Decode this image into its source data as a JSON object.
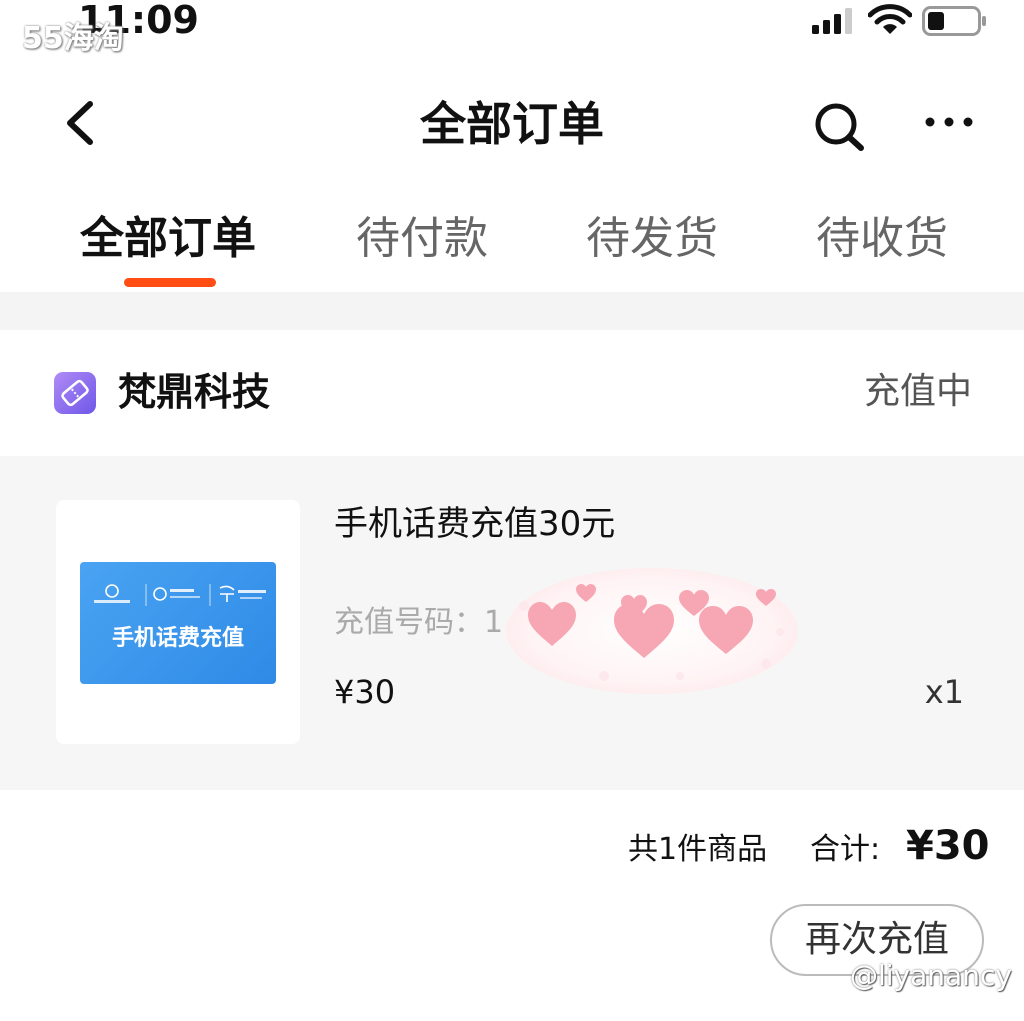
{
  "status_bar": {
    "time": "11:09",
    "battery_level": 0.35
  },
  "watermark": {
    "top": "55海淘",
    "bottom": "@liyanancy"
  },
  "header": {
    "title": "全部订单"
  },
  "tabs": [
    {
      "label": "全部订单",
      "active": true
    },
    {
      "label": "待付款",
      "active": false
    },
    {
      "label": "待发货",
      "active": false
    },
    {
      "label": "待收货",
      "active": false
    }
  ],
  "order": {
    "shop_name": "梵鼎科技",
    "status": "充值中",
    "thumbnail_text": "手机话费充值",
    "item_name": "手机话费充值30元",
    "recharge_number": "充值号码：1",
    "price": "¥30",
    "quantity": "x1",
    "total_count": "共1件商品",
    "total_label": "合计:",
    "total_amount": "¥30",
    "action_label": "再次充值"
  },
  "colors": {
    "accent": "#ff4d14",
    "banner_blue": "#3a93ea",
    "shop_icon": "#8a6df0"
  },
  "icons": [
    "back-icon",
    "search-icon",
    "more-icon",
    "shop-icon",
    "signal-icon",
    "wifi-icon",
    "battery-icon"
  ]
}
